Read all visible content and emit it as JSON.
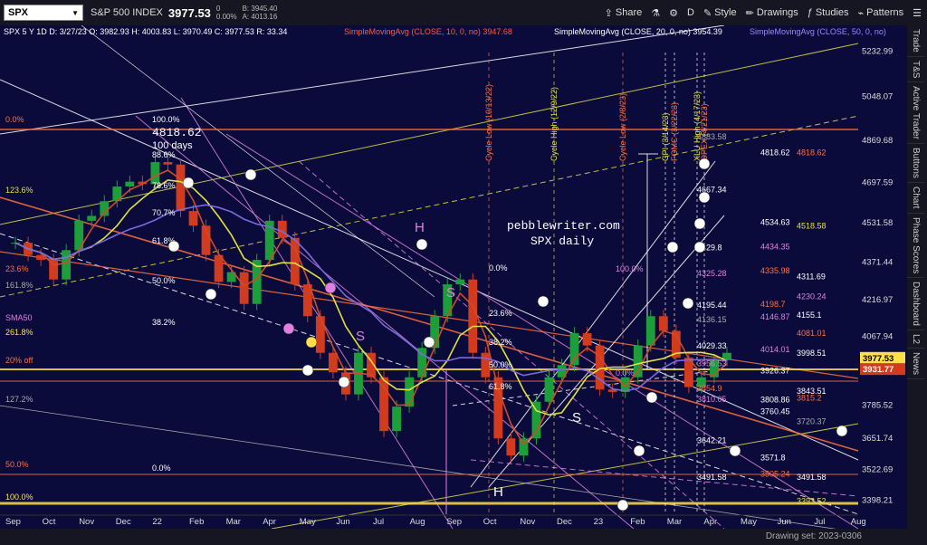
{
  "topbar": {
    "symbol": "SPX",
    "name": "S&P 500 INDEX",
    "price": "3977.53",
    "change": "0",
    "change_pct": "0.00%",
    "bid": "B: 3945.40",
    "ask": "A: 4013.16",
    "share_label": "Share",
    "period_label": "D",
    "style_label": "Style",
    "drawings_label": "Drawings",
    "studies_label": "Studies",
    "patterns_label": "Patterns"
  },
  "legend": {
    "ohlc": "SPX 5 Y 1D  D: 3/27/23  O: 3982.93  H: 4003.83  L: 3970.49  C: 3977.53  R: 33.34",
    "sma10": "SimpleMovingAvg (CLOSE, 10, 0, no)  3947.68",
    "sma20": "SimpleMovingAvg (CLOSE, 20, 0, no)  3954.39",
    "sma50": "SimpleMovingAvg (CLOSE, 50, 0, no)"
  },
  "sidebar_tabs": [
    "Trade",
    "T&S",
    "Active Trader",
    "Buttons",
    "Chart",
    "Phase Scores",
    "Dashboard",
    "L2",
    "News"
  ],
  "bottombar": {
    "drawing_set": "Drawing set: 2023-0306"
  },
  "watermark": {
    "line1": "pebblewriter.com",
    "line2": "SPX daily"
  },
  "chart_data": {
    "type": "candlestick",
    "ylim": [
      3340,
      5280
    ],
    "x_ticks": [
      "Sep",
      "Oct",
      "Nov",
      "Dec",
      "22",
      "Feb",
      "Mar",
      "Apr",
      "May",
      "Jun",
      "Jul",
      "Aug",
      "Sep",
      "Oct",
      "Nov",
      "Dec",
      "23",
      "Feb",
      "Mar",
      "Apr",
      "May",
      "Jun",
      "Jul",
      "Aug"
    ],
    "y_ticks": [
      "5232.99",
      "5048.07",
      "4869.68",
      "4697.59",
      "4531.58",
      "4371.44",
      "4216.97",
      "4067.94",
      "3924.43",
      "3785.52",
      "3651.74",
      "3522.69",
      "3398.21"
    ],
    "last_price": "3977.53",
    "sma_price": "3931.77",
    "close_series": [
      4450,
      4400,
      4380,
      4300,
      4420,
      4540,
      4560,
      4620,
      4680,
      4700,
      4690,
      4780,
      4770,
      4580,
      4520,
      4400,
      4290,
      4330,
      4200,
      4380,
      4540,
      4470,
      4280,
      4150,
      4000,
      3920,
      3830,
      4000,
      3900,
      3680,
      3780,
      3900,
      4020,
      4150,
      4280,
      4300,
      4000,
      3900,
      3650,
      3580,
      3650,
      3800,
      3900,
      3950,
      4080,
      4030,
      3850,
      3840,
      3900,
      4030,
      4150,
      4090,
      3980,
      3860,
      3900,
      3970,
      4000
    ],
    "annotations": {
      "cycle_labels": [
        "Cycle Low (10/13/22)",
        "Cycle High (12/9/22)",
        "Cycle Low (2/8/23)",
        "CPI (3/14/23)",
        "FOMC (3/22/23)",
        "XLU High (4/17/23)",
        "OPEX (4/21/23)"
      ],
      "top_label": "4818.62",
      "days_label": "100 days",
      "pattern_letters": [
        "H",
        "S",
        "S",
        "S",
        "H"
      ],
      "level_labels_right": [
        "4883.58",
        "4818.62",
        "4818.62",
        "4667.34",
        "4534.63",
        "4518.58",
        "4429.8",
        "4434.35",
        "4311.69",
        "4325.28",
        "4335.98",
        "4230.24",
        "4195.44",
        "4198.7",
        "4155.1",
        "4136.15",
        "4146.87",
        "4081.01",
        "4029.33",
        "4014.01",
        "3998.51",
        "3956.53",
        "3926.37",
        "3843.51",
        "3854.9",
        "3808.86",
        "3815.2",
        "3810.05",
        "3760.45",
        "3720.37",
        "3642.21",
        "3571.8",
        "3491.58",
        "3491.58",
        "3505.24",
        "3393.52"
      ],
      "fib_labels": [
        "0.0%",
        "100.0%",
        "88.6%",
        "78.6%",
        "70.7%",
        "61.8%",
        "50.0%",
        "38.2%",
        "23.6%",
        "161.8%",
        "127.2%",
        "123.6%",
        "20% off",
        "50.0%",
        "100.0%",
        "0.0%",
        "0.0%",
        "38.2%",
        "61.8%",
        "50.0%",
        "23.6%",
        "0.0%",
        "100.0%",
        "SMA50",
        "261.8%"
      ]
    }
  },
  "colors": {
    "background": "#0a0b3a",
    "candle_up": "#1e9e3a",
    "candle_down": "#d23b1e",
    "sma10": "#d04a2a",
    "sma20": "#e0e040",
    "sma50": "#7a6ae0",
    "fib_orange": "#ff7040",
    "pink": "#e080e0"
  }
}
